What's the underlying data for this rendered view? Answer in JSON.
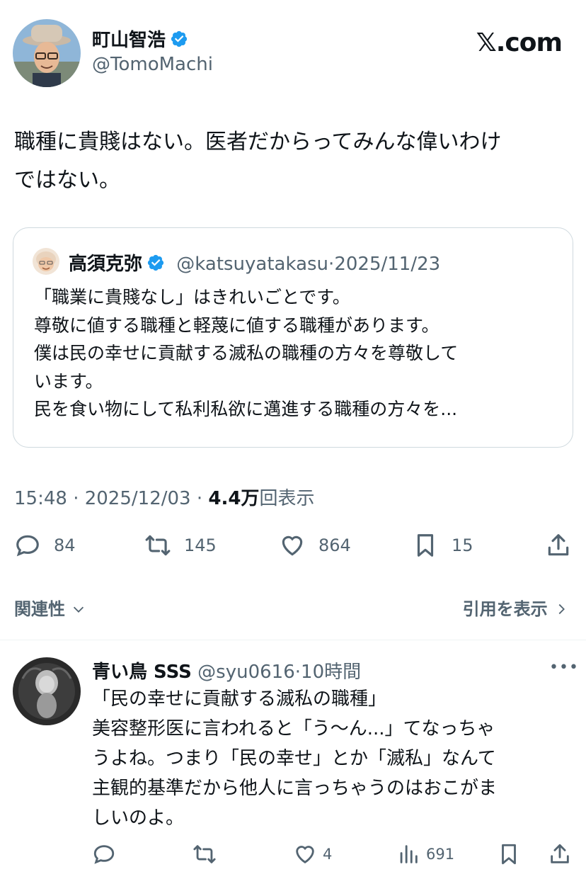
{
  "site_logo": "𝕏.com",
  "tweet": {
    "author_name": "町山智浩",
    "author_handle": "@TomoMachi",
    "text_lines": [
      "職種に貴賤はない。医者だからってみんな偉いわけ",
      "ではない。"
    ],
    "timestamp_prefix": "15:48 · 2025/12/03 · ",
    "views_count": "4.4万",
    "views_label": "回表示"
  },
  "quote": {
    "author_name": "高須克弥",
    "author_handle": "@katsuyatakasu",
    "date": "2025/11/23",
    "lines": [
      "「職業に貴賤なし」はきれいごとです。",
      "尊敬に値する職種と軽蔑に値する職種があります。",
      "僕は民の幸せに貢献する滅私の職種の方々を尊敬して",
      "います。",
      "民を食い物にして私利私欲に邁進する職種の方々を..."
    ]
  },
  "actions": {
    "replies": "84",
    "reposts": "145",
    "likes": "864",
    "bookmarks": "15"
  },
  "reply_filter": {
    "label": "関連性"
  },
  "quotes_link": {
    "label": "引用を表示"
  },
  "reply": {
    "author_name": "青い鳥 SSS",
    "author_handle": "@syu0616",
    "time": "10時間",
    "more": "•••",
    "lines": [
      "「民の幸せに貢献する滅私の職種」",
      "美容整形医に言われると「う〜ん...」てなっちゃ",
      "うよね。つまり「民の幸せ」とか「滅私」なんて",
      "主観的基準だから他人に言っちゃうのはおこがま",
      "しいのよ。"
    ],
    "likes": "4",
    "views": "691"
  },
  "colors": {
    "verified_blue": "#1d9bf0",
    "secondary_text": "#536471",
    "border": "#cfd9de"
  }
}
